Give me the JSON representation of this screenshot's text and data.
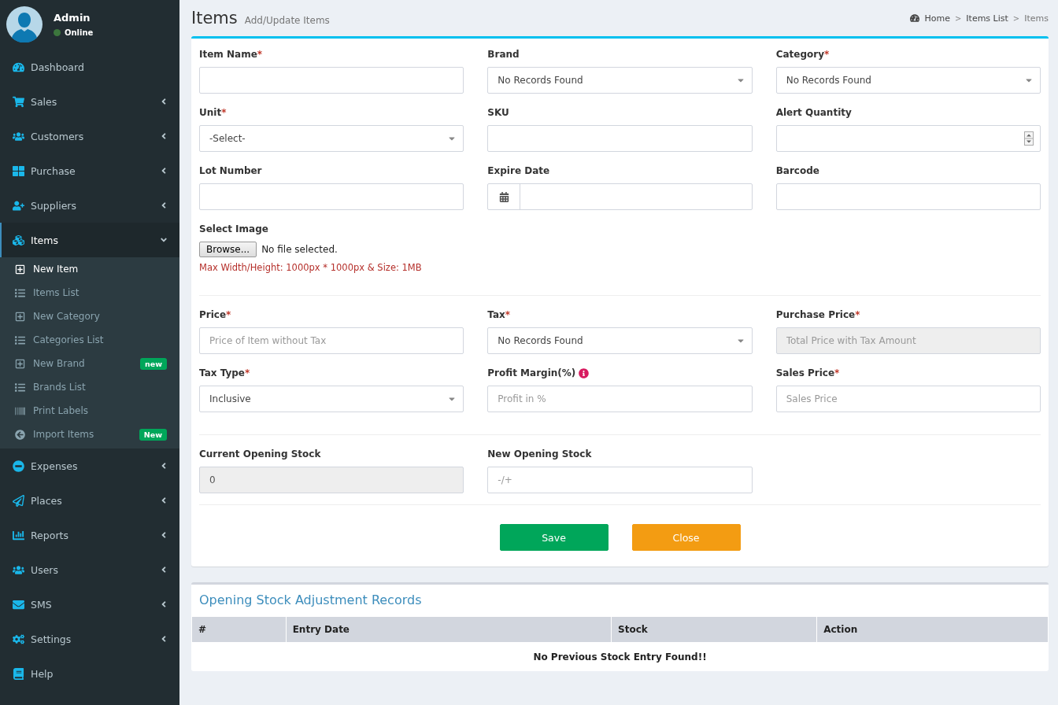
{
  "user": {
    "name": "Admin",
    "status": "Online",
    "online": true
  },
  "sidebar": {
    "items": [
      {
        "label": "Dashboard",
        "selected": false
      },
      {
        "label": "Sales",
        "expanded": false,
        "selected": false
      },
      {
        "label": "Customers",
        "expanded": false,
        "selected": false
      },
      {
        "label": "Purchase",
        "expanded": false,
        "selected": false
      },
      {
        "label": "Suppliers",
        "expanded": false,
        "selected": false
      },
      {
        "label": "Items",
        "expanded": true,
        "selected": true,
        "children": [
          {
            "label": "New Item",
            "selected": true
          },
          {
            "label": "Items List",
            "selected": false
          },
          {
            "label": "New Category",
            "selected": false
          },
          {
            "label": "Categories List",
            "selected": false
          },
          {
            "label": "New Brand",
            "selected": false,
            "badge": {
              "text": "new",
              "color": "#00a65a"
            }
          },
          {
            "label": "Brands List",
            "selected": false
          },
          {
            "label": "Print Labels",
            "selected": false
          },
          {
            "label": "Import Items",
            "selected": false,
            "badge": {
              "text": "New",
              "color": "#00a65a"
            }
          }
        ]
      },
      {
        "label": "Expenses",
        "expanded": false,
        "selected": false
      },
      {
        "label": "Places",
        "expanded": false,
        "selected": false
      },
      {
        "label": "Reports",
        "expanded": false,
        "selected": false
      },
      {
        "label": "Users",
        "expanded": false,
        "selected": false
      },
      {
        "label": "SMS",
        "expanded": false,
        "selected": false
      },
      {
        "label": "Settings",
        "expanded": false,
        "selected": false
      },
      {
        "label": "Help",
        "selected": false
      }
    ]
  },
  "header": {
    "title": "Items",
    "subtitle": "Add/Update Items",
    "separator": ">",
    "breadcrumb": [
      "Home",
      "Items List",
      "Items"
    ]
  },
  "form": {
    "sections": [
      {
        "fields": [
          {
            "label": "Item Name",
            "mark": "*",
            "kind": "text"
          },
          {
            "label": "Brand",
            "kind": "select",
            "value": "No Records Found"
          },
          {
            "label": "Category",
            "mark": "*",
            "kind": "select",
            "value": "No Records Found"
          },
          {
            "label": "Unit",
            "mark": "*",
            "kind": "select",
            "value": "-Select-"
          },
          {
            "label": "SKU",
            "kind": "text"
          },
          {
            "label": "Alert Quantity",
            "kind": "number"
          },
          {
            "label": "Lot Number",
            "kind": "text"
          },
          {
            "label": "Expire Date",
            "kind": "date"
          },
          {
            "label": "Barcode",
            "kind": "text"
          },
          {
            "label": "Select Image",
            "kind": "file",
            "button": "Browse...",
            "value": "No file selected.",
            "hint": "Max Width/Height: 1000px * 1000px & Size: 1MB"
          }
        ]
      },
      {
        "fields": [
          {
            "label": "Price",
            "mark": "*",
            "kind": "text",
            "placeholder": "Price of Item without Tax"
          },
          {
            "label": "Tax",
            "mark": "*",
            "kind": "select",
            "value": "No Records Found"
          },
          {
            "label": "Purchase Price",
            "mark": "*",
            "kind": "readonly",
            "placeholder": "Total Price with Tax Amount"
          },
          {
            "label": "Tax Type",
            "mark": "*",
            "kind": "select",
            "value": "Inclusive"
          },
          {
            "label": "Profit Margin(%)",
            "info": true,
            "kind": "text",
            "placeholder": "Profit in %"
          },
          {
            "label": "Sales Price",
            "mark": "*",
            "kind": "text",
            "placeholder": "Sales Price"
          }
        ]
      },
      {
        "fields": [
          {
            "label": "Current Opening Stock",
            "kind": "readonly",
            "value": "0"
          },
          {
            "label": "New Opening Stock",
            "kind": "text",
            "placeholder": "-/+"
          }
        ]
      }
    ],
    "buttons": [
      {
        "label": "Save",
        "kind": "save"
      },
      {
        "label": "Close",
        "kind": "close"
      }
    ]
  },
  "records": {
    "title": "Opening Stock Adjustment Records",
    "columns": [
      "#",
      "Entry Date",
      "Stock",
      "Action"
    ],
    "empty": "No Previous Stock Entry Found!!"
  }
}
